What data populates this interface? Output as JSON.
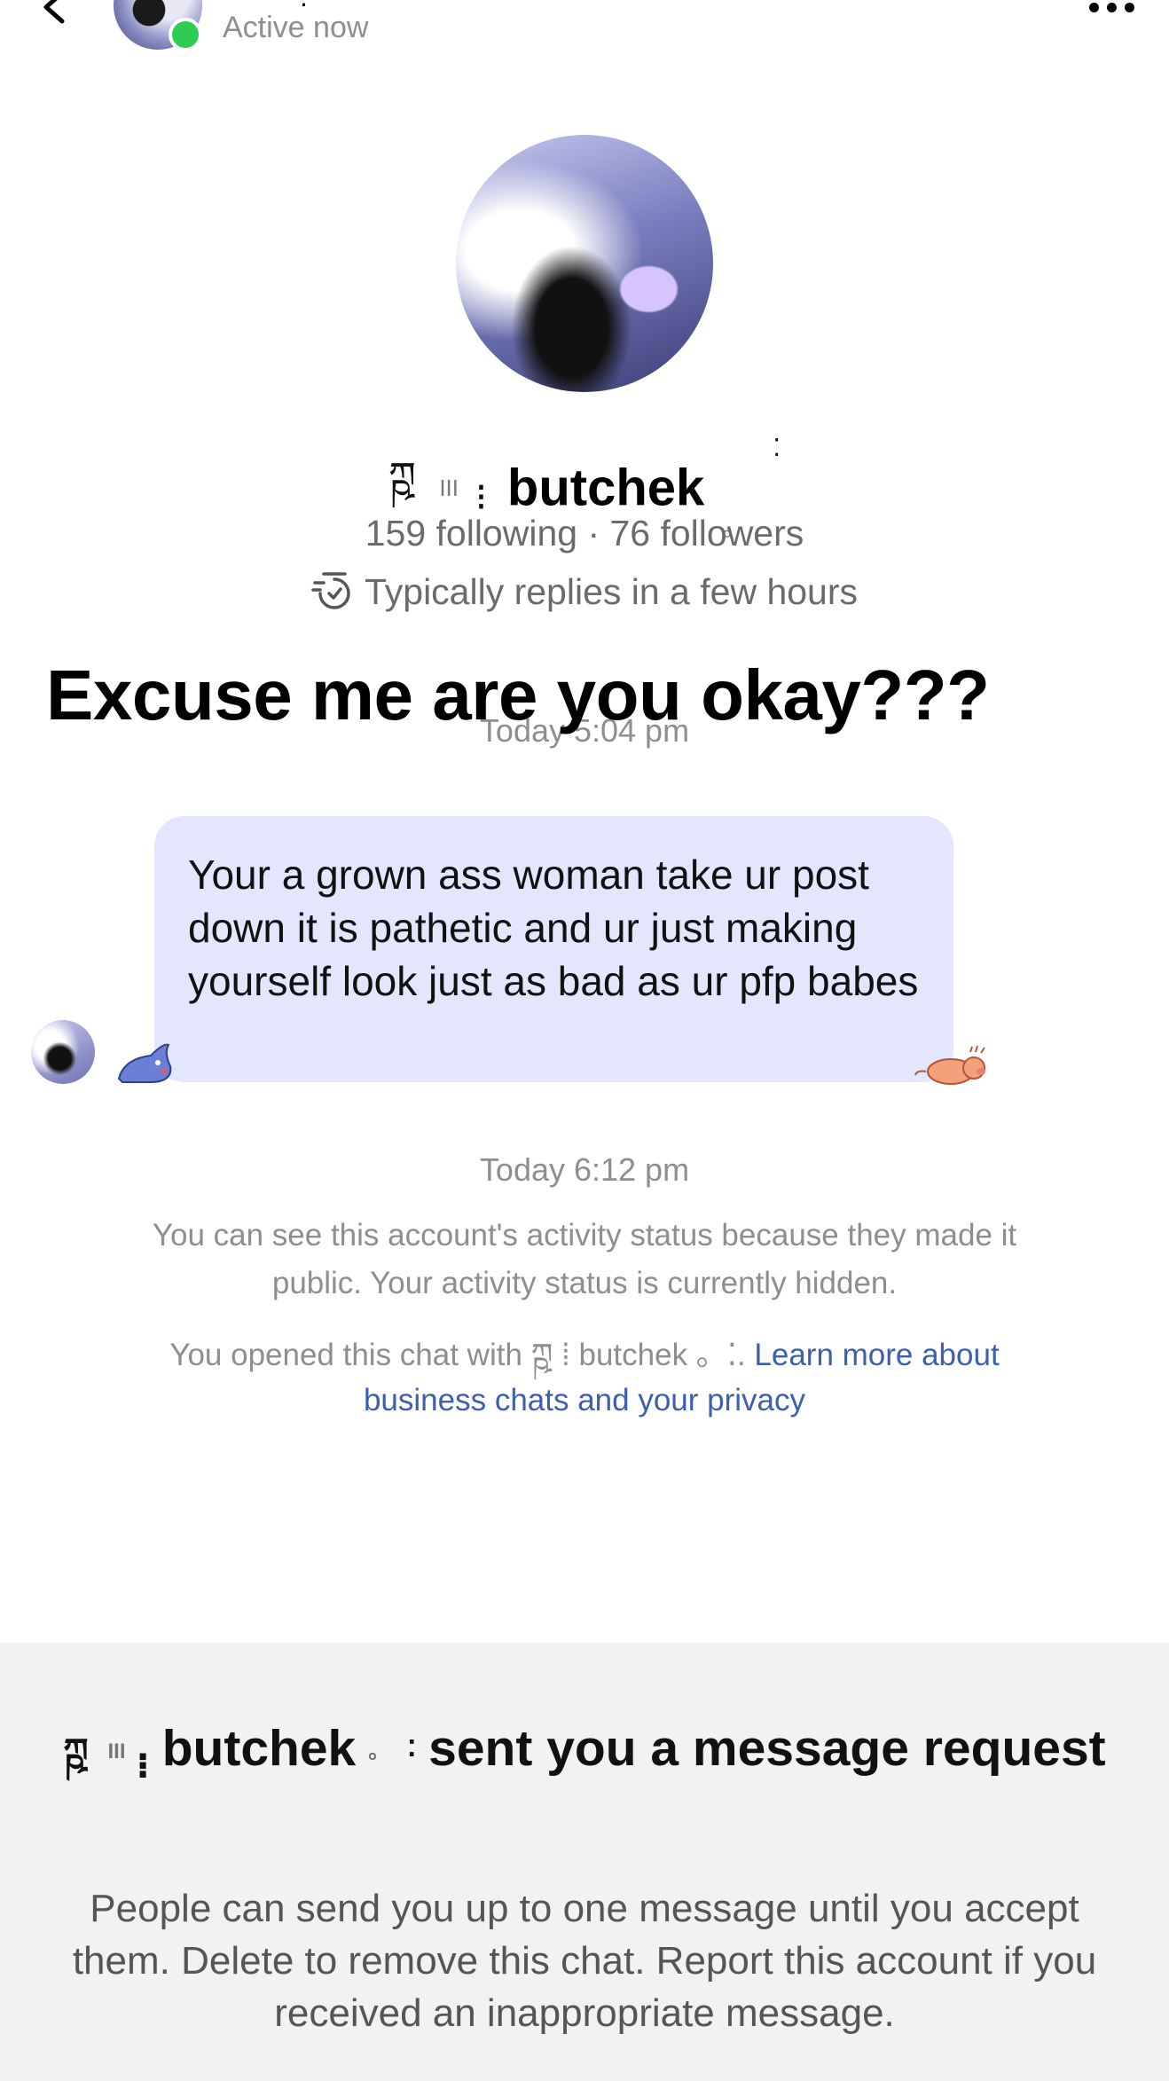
{
  "header": {
    "back_icon": "chevron-left-icon",
    "name_glyph": "⁝",
    "status": "Active now",
    "more_icon": "more-horizontal-icon",
    "online_color": "#2ecc53"
  },
  "profile": {
    "deco_prefix_1": "ཀྵ",
    "deco_prefix_2": "III",
    "deco_prefix_3": "⁝",
    "name": "butchek",
    "deco_suffix_1": "。",
    "deco_suffix_2": "⁚",
    "follow_stats": "159 following · 76 followers",
    "reply_time": "Typically replies in a few hours"
  },
  "overlay_caption": "Excuse me are you okay???",
  "conversation": {
    "timestamp_1": "Today 5:04 pm",
    "message": "Your a grown ass woman take ur post down it is pathetic and ur just making yourself look just as bad as ur pfp babes",
    "bubble_color": "#e3e6fd",
    "timestamp_2": "Today 6:12 pm",
    "activity_note": "You can see this account's activity status because they made it public. Your activity status is currently hidden.",
    "privacy_prefix": "You opened this chat with",
    "privacy_name": "ཀྵ ⁞ butchek 。⁚.",
    "privacy_link": "Learn more about business chats and your privacy"
  },
  "request": {
    "name": "butchek",
    "title_suffix": "sent you a message request",
    "description": "People can send you up to one message until you accept them. Delete to remove this chat. Report this account if you received an inappropriate message."
  }
}
